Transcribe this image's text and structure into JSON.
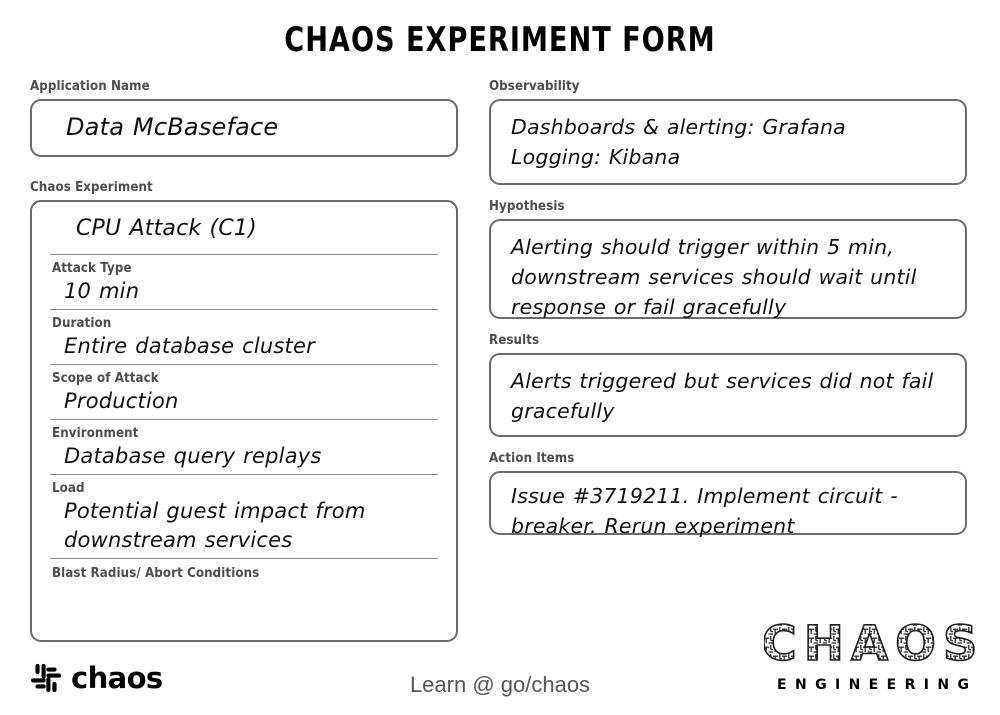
{
  "title": "CHAOS EXPERIMENT FORM",
  "left": {
    "application_name": {
      "label": "Application Name",
      "value": "Data McBaseface"
    },
    "chaos_experiment": {
      "label": "Chaos Experiment",
      "first_value": "CPU Attack (C1)",
      "rows": [
        {
          "label": "Attack Type",
          "value": "10 min"
        },
        {
          "label": "Duration",
          "value": "Entire database cluster"
        },
        {
          "label": "Scope of Attack",
          "value": "Production"
        },
        {
          "label": "Environment",
          "value": "Database query replays"
        },
        {
          "label": "Load",
          "value": "Potential guest impact from downstream services"
        }
      ],
      "last_label": "Blast Radius/ Abort Conditions"
    }
  },
  "right": {
    "observability": {
      "label": "Observability",
      "lines": [
        "Dashboards & alerting: Grafana",
        "Logging: Kibana"
      ]
    },
    "hypothesis": {
      "label": "Hypothesis",
      "value": "Alerting should trigger within 5 min, downstream services should wait until response or fail gracefully"
    },
    "results": {
      "label": "Results",
      "value": "Alerts triggered but services did not fail gracefully"
    },
    "action_items": {
      "label": "Action Items",
      "value": "Issue #3719211. Implement circuit - breaker. Rerun experiment"
    }
  },
  "footer": {
    "learn_text": "Learn @ go/chaos",
    "chaos_wordmark": "chaos",
    "brand_title": "CHAOS",
    "brand_subtitle": "ENGINEERING"
  },
  "colors": {
    "label": "#4d4d4d",
    "border": "#6b6b6b",
    "divider": "#8c8c8c",
    "handwriting": "#111111",
    "footer_text": "#575757"
  }
}
